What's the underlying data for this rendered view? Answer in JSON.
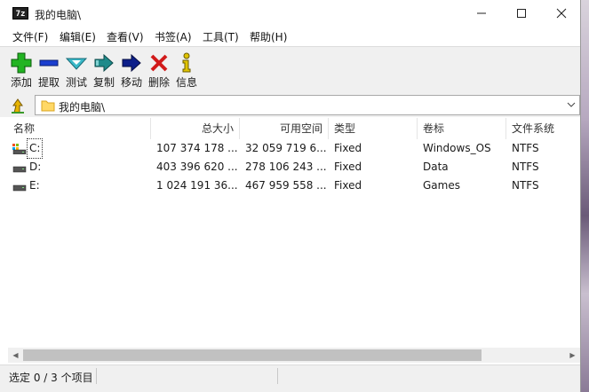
{
  "window": {
    "title": "我的电脑\\",
    "app_icon_text": "7z"
  },
  "menu": [
    "文件(F)",
    "编辑(E)",
    "查看(V)",
    "书签(A)",
    "工具(T)",
    "帮助(H)"
  ],
  "toolbar": {
    "add": "添加",
    "extract": "提取",
    "test": "测试",
    "copy": "复制",
    "move": "移动",
    "delete": "删除",
    "info": "信息"
  },
  "address": {
    "path": "我的电脑\\"
  },
  "columns": {
    "name": "名称",
    "total_size": "总大小",
    "free_space": "可用空间",
    "type": "类型",
    "label": "卷标",
    "filesystem": "文件系统"
  },
  "drives": [
    {
      "name": "C:",
      "total": "107 374 178 ...",
      "free": "32 059 719 6...",
      "type": "Fixed",
      "label": "Windows_OS",
      "fs": "NTFS"
    },
    {
      "name": "D:",
      "total": "403 396 620 ...",
      "free": "278 106 243 ...",
      "type": "Fixed",
      "label": "Data",
      "fs": "NTFS"
    },
    {
      "name": "E:",
      "total": "1 024 191 36...",
      "free": "467 959 558 ...",
      "type": "Fixed",
      "label": "Games",
      "fs": "NTFS"
    }
  ],
  "status": {
    "selection": "选定 0 / 3 个项目"
  },
  "colors": {
    "add": "#22b422",
    "extract": "#1b3fcf",
    "test": "#38b8c8",
    "copy": "#1f8a8a",
    "move": "#0d1f8a",
    "delete": "#d11a1a",
    "info": "#e0c400"
  }
}
